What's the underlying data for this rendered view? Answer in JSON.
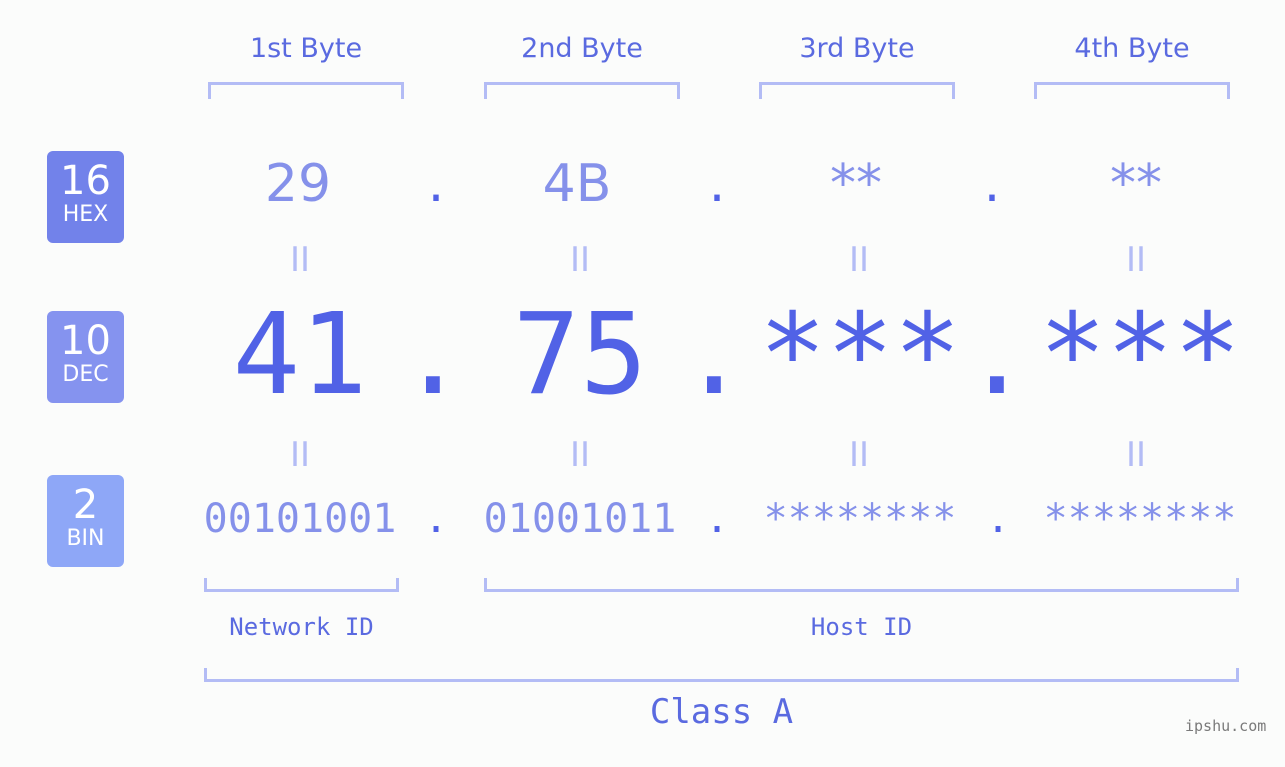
{
  "headers": [
    "1st Byte",
    "2nd Byte",
    "3rd Byte",
    "4th Byte"
  ],
  "badges": [
    {
      "num": "16",
      "label": "HEX",
      "color": "#7282ea"
    },
    {
      "num": "10",
      "label": "DEC",
      "color": "#8593ef"
    },
    {
      "num": "2",
      "label": "BIN",
      "color": "#8ea7f7"
    }
  ],
  "hex": [
    "29",
    "4B",
    "**",
    "**"
  ],
  "dec": [
    "41",
    "75",
    "***",
    "***"
  ],
  "bin": [
    "00101001",
    "01001011",
    "********",
    "********"
  ],
  "separator": ".",
  "equals": "II",
  "network_id_label": "Network ID",
  "host_id_label": "Host ID",
  "class_label": "Class A",
  "watermark": "ipshu.com",
  "colors": {
    "accent": "#5162e6",
    "light": "#8591ea",
    "bracket": "#b3bcf5",
    "background": "#fbfcfb"
  }
}
